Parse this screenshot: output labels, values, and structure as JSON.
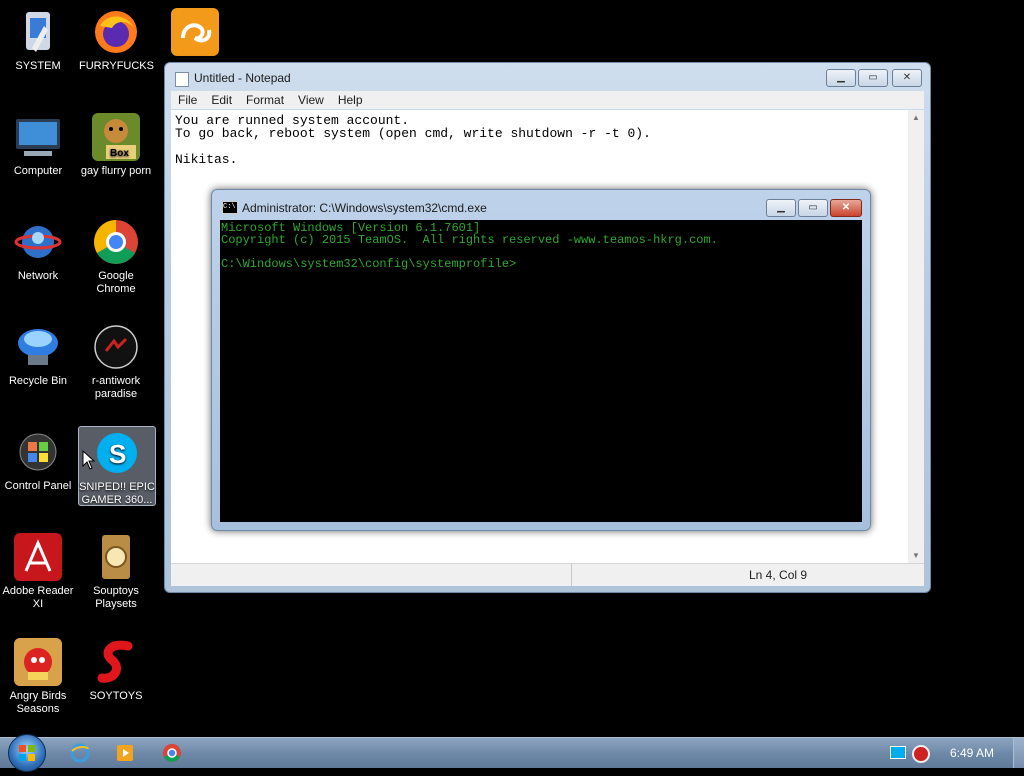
{
  "desktop_icons": [
    {
      "label": "SYSTEM"
    },
    {
      "label": "FURRYFUCKS"
    },
    {
      "label": ""
    },
    {
      "label": "Computer"
    },
    {
      "label": "gay flurry porn"
    },
    {
      "label": "Network"
    },
    {
      "label": "Google Chrome"
    },
    {
      "label": "Recycle Bin"
    },
    {
      "label": "r-antiwork paradise"
    },
    {
      "label": "Control Panel"
    },
    {
      "label": "SNIPED!! EPIC GAMER 360..."
    },
    {
      "label": "Adobe Reader XI"
    },
    {
      "label": "Souptoys Playsets"
    },
    {
      "label": "Angry Birds Seasons"
    },
    {
      "label": "SOYTOYS"
    }
  ],
  "notepad": {
    "title": "Untitled - Notepad",
    "menu": [
      "File",
      "Edit",
      "Format",
      "View",
      "Help"
    ],
    "text": "You are runned system account.\nTo go back, reboot system (open cmd, write shutdown -r -t 0).\n\nNikitas.",
    "status": "Ln 4, Col 9",
    "min_label": "▁",
    "max_label": "▭",
    "close_label": "✕"
  },
  "cmd": {
    "title": "Administrator: C:\\Windows\\system32\\cmd.exe",
    "icon_text": "C:\\",
    "text": "Microsoft Windows [Version 6.1.7601]\nCopyright (c) 2015 TeamOS.  All rights reserved -www.teamos-hkrg.com.\n\nC:\\Windows\\system32\\config\\systemprofile>",
    "min_label": "▁",
    "max_label": "▭",
    "close_label": "✕"
  },
  "taskbar": {
    "clock": "6:49 AM"
  },
  "colors": {
    "cmd_text": "#2fa82f",
    "desktop_bg": "#000000"
  }
}
